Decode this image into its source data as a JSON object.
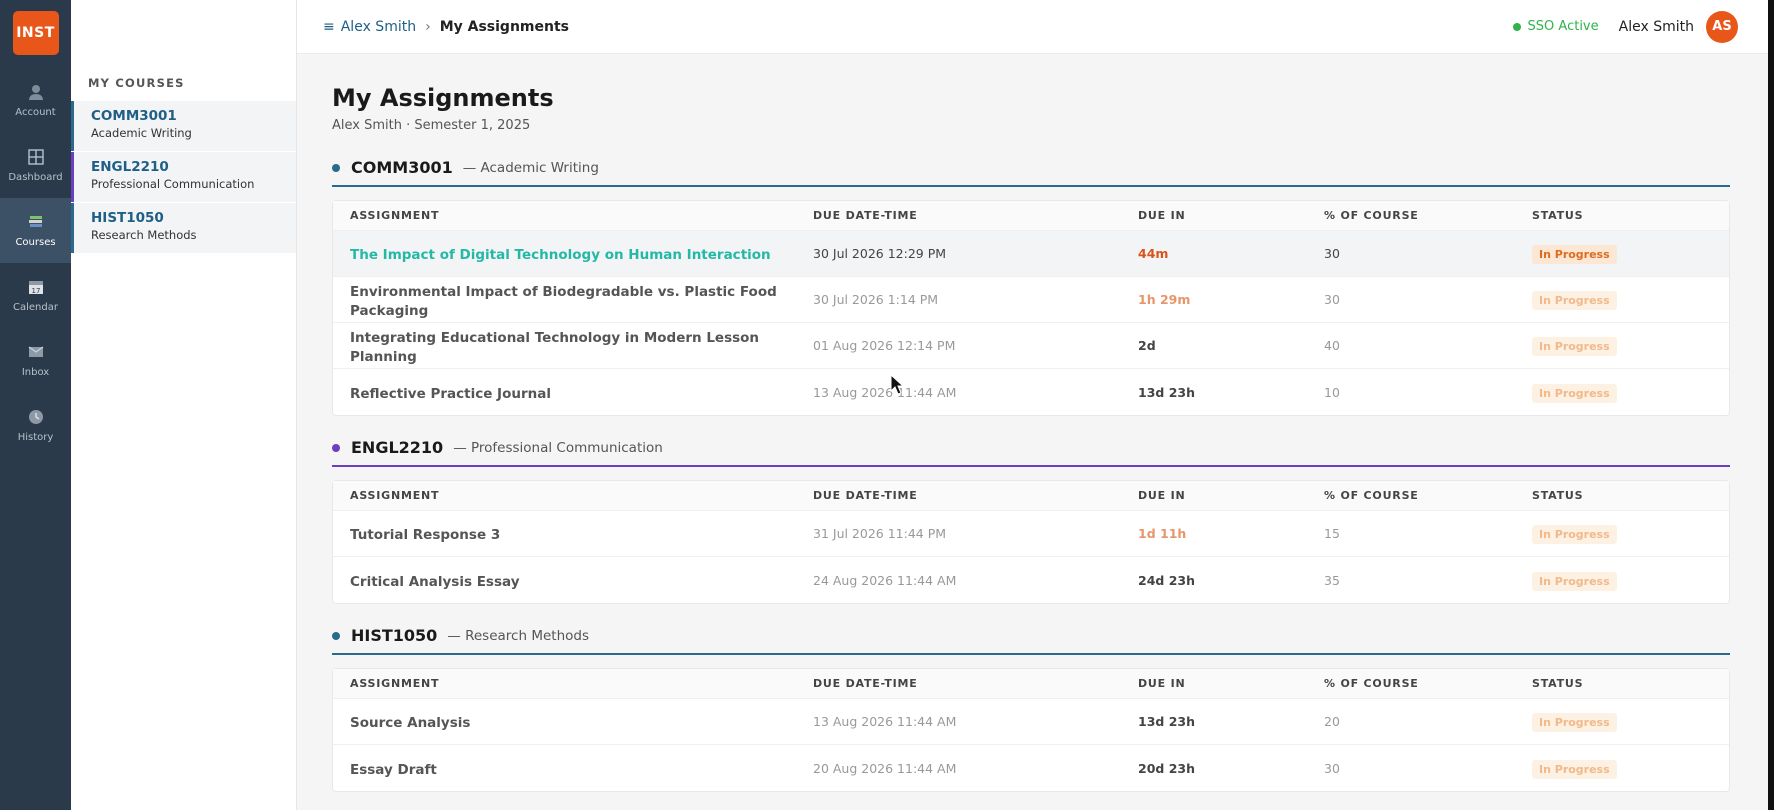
{
  "nav": {
    "logo": "INST",
    "items": [
      {
        "key": "account",
        "label": "Account",
        "icon": "account-icon",
        "active": false
      },
      {
        "key": "dashboard",
        "label": "Dashboard",
        "icon": "dashboard-icon",
        "active": false
      },
      {
        "key": "courses",
        "label": "Courses",
        "icon": "courses-icon",
        "active": true
      },
      {
        "key": "calendar",
        "label": "Calendar",
        "icon": "calendar-icon",
        "active": false
      },
      {
        "key": "inbox",
        "label": "Inbox",
        "icon": "inbox-icon",
        "active": false
      },
      {
        "key": "history",
        "label": "History",
        "icon": "history-icon",
        "active": false
      }
    ],
    "calendar_day": "17"
  },
  "sidebar": {
    "heading": "MY COURSES",
    "courses": [
      {
        "code": "COMM3001",
        "name": "Academic Writing",
        "accent": "#2a6a8e"
      },
      {
        "code": "ENGL2210",
        "name": "Professional Communication",
        "accent": "#6a3fc0"
      },
      {
        "code": "HIST1050",
        "name": "Research Methods",
        "accent": "#2a6a8e"
      }
    ]
  },
  "header": {
    "breadcrumb_parent": "Alex Smith",
    "breadcrumb_separator": "›",
    "breadcrumb_current": "My Assignments",
    "sso_status": "SSO Active",
    "user_name": "Alex Smith",
    "avatar_initials": "AS"
  },
  "page": {
    "title": "My Assignments",
    "subtitle": "Alex Smith · Semester 1, 2025"
  },
  "table_headers": {
    "assignment": "ASSIGNMENT",
    "due": "DUE DATE-TIME",
    "due_in": "DUE IN",
    "pct": "% OF COURSE",
    "status": "STATUS"
  },
  "sections": [
    {
      "code": "COMM3001",
      "name": "— Academic Writing",
      "dot_color": "#2a6a8e",
      "rows": [
        {
          "title": "The Impact of Digital Technology on Human Interaction",
          "due": "30 Jul 2026 12:29 PM",
          "due_in": "44m",
          "pct": "30",
          "status": "In Progress"
        },
        {
          "title": "Environmental Impact of Biodegradable vs. Plastic Food Packaging",
          "due": "30 Jul 2026 1:14 PM",
          "due_in": "1h 29m",
          "pct": "30",
          "status": "In Progress"
        },
        {
          "title": "Integrating Educational Technology in Modern Lesson Planning",
          "due": "01 Aug 2026 12:14 PM",
          "due_in": "2d",
          "pct": "40",
          "status": "In Progress"
        },
        {
          "title": "Reflective Practice Journal",
          "due": "13 Aug 2026 11:44 AM",
          "due_in": "13d 23h",
          "pct": "10",
          "status": "In Progress"
        }
      ]
    },
    {
      "code": "ENGL2210",
      "name": "— Professional Communication",
      "dot_color": "#6a3fc0",
      "rows": [
        {
          "title": "Tutorial Response 3",
          "due": "31 Jul 2026 11:44 PM",
          "due_in": "1d 11h",
          "pct": "15",
          "status": "In Progress"
        },
        {
          "title": "Critical Analysis Essay",
          "due": "24 Aug 2026 11:44 AM",
          "due_in": "24d 23h",
          "pct": "35",
          "status": "In Progress"
        }
      ]
    },
    {
      "code": "HIST1050",
      "name": "— Research Methods",
      "dot_color": "#2a6a8e",
      "rows": [
        {
          "title": "Source Analysis",
          "due": "13 Aug 2026 11:44 AM",
          "due_in": "13d 23h",
          "pct": "20",
          "status": "In Progress"
        },
        {
          "title": "Essay Draft",
          "due": "20 Aug 2026 11:44 AM",
          "due_in": "20d 23h",
          "pct": "30",
          "status": "In Progress"
        }
      ]
    }
  ]
}
